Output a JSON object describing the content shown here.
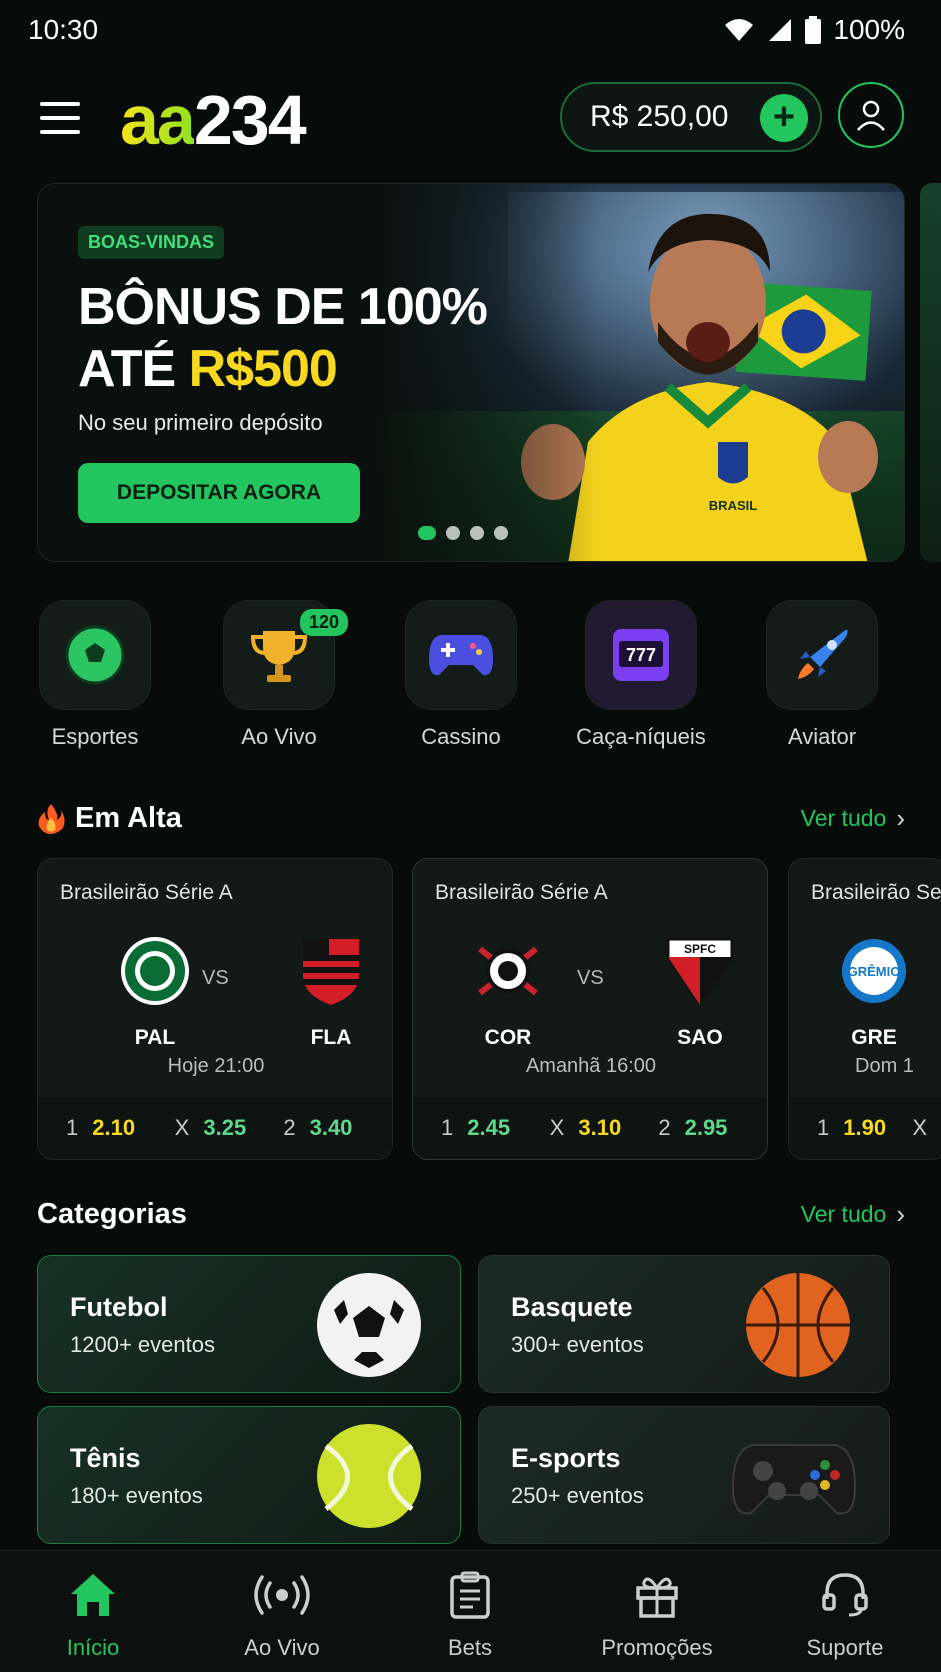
{
  "status_bar": {
    "time": "10:30",
    "battery": "100%"
  },
  "header": {
    "logo_part1": "aa",
    "logo_part2": "234",
    "balance": "R$ 250,00"
  },
  "banner": {
    "tag": "BOAS-VINDAS",
    "headline_line1": "BÔNUS DE 100%",
    "headline_line2_prefix": "ATÉ ",
    "headline_line2_amount": "R$500",
    "subtitle": "No seu primeiro depósito",
    "cta": "DEPOSITAR AGORA",
    "player_shirt_text": "BRASIL"
  },
  "quick_links": [
    {
      "label": "Esportes",
      "icon": "soccer-ball-icon"
    },
    {
      "label": "Ao Vivo",
      "icon": "trophy-icon",
      "badge": "120"
    },
    {
      "label": "Cassino",
      "icon": "gamepad-icon"
    },
    {
      "label": "Caça-níqueis",
      "icon": "slot-machine-icon",
      "slot_text": "777"
    },
    {
      "label": "Aviator",
      "icon": "rocket-icon"
    }
  ],
  "trending": {
    "title": "Em Alta",
    "see_all": "Ver tudo",
    "matches": [
      {
        "league": "Brasileirão Série A",
        "home": "PAL",
        "away": "FLA",
        "vs": "VS",
        "time": "Hoje 21:00",
        "odds": [
          {
            "k": "1",
            "v": "2.10"
          },
          {
            "k": "X",
            "v": "3.25"
          },
          {
            "k": "2",
            "v": "3.40"
          }
        ]
      },
      {
        "league": "Brasileirão Série A",
        "home": "COR",
        "away": "SAO",
        "vs": "VS",
        "time": "Amanhã 16:00",
        "odds": [
          {
            "k": "1",
            "v": "2.45"
          },
          {
            "k": "X",
            "v": "3.10"
          },
          {
            "k": "2",
            "v": "2.95"
          }
        ]
      },
      {
        "league": "Brasileirão Se",
        "home": "GRE",
        "time": "Dom 1",
        "odds": [
          {
            "k": "1",
            "v": "1.90"
          },
          {
            "k": "X",
            "v": ""
          }
        ]
      }
    ],
    "crest_texts": {
      "sao": "SPFC",
      "gre": "GRÊMIO"
    }
  },
  "categories": {
    "title": "Categorias",
    "see_all": "Ver tudo",
    "items": [
      {
        "name": "Futebol",
        "count": "1200+ eventos"
      },
      {
        "name": "Basquete",
        "count": "300+ eventos"
      },
      {
        "name": "Tênis",
        "count": "180+ eventos"
      },
      {
        "name": "E-sports",
        "count": "250+ eventos"
      }
    ]
  },
  "tabbar": [
    {
      "label": "Início",
      "icon": "home-icon",
      "active": true
    },
    {
      "label": "Ao Vivo",
      "icon": "live-broadcast-icon"
    },
    {
      "label": "Bets",
      "icon": "clipboard-icon"
    },
    {
      "label": "Promoções",
      "icon": "gift-icon"
    },
    {
      "label": "Suporte",
      "icon": "headset-icon"
    }
  ],
  "colors": {
    "accent": "#22c55e",
    "yellow": "#f8d920",
    "background": "#070b0a"
  }
}
